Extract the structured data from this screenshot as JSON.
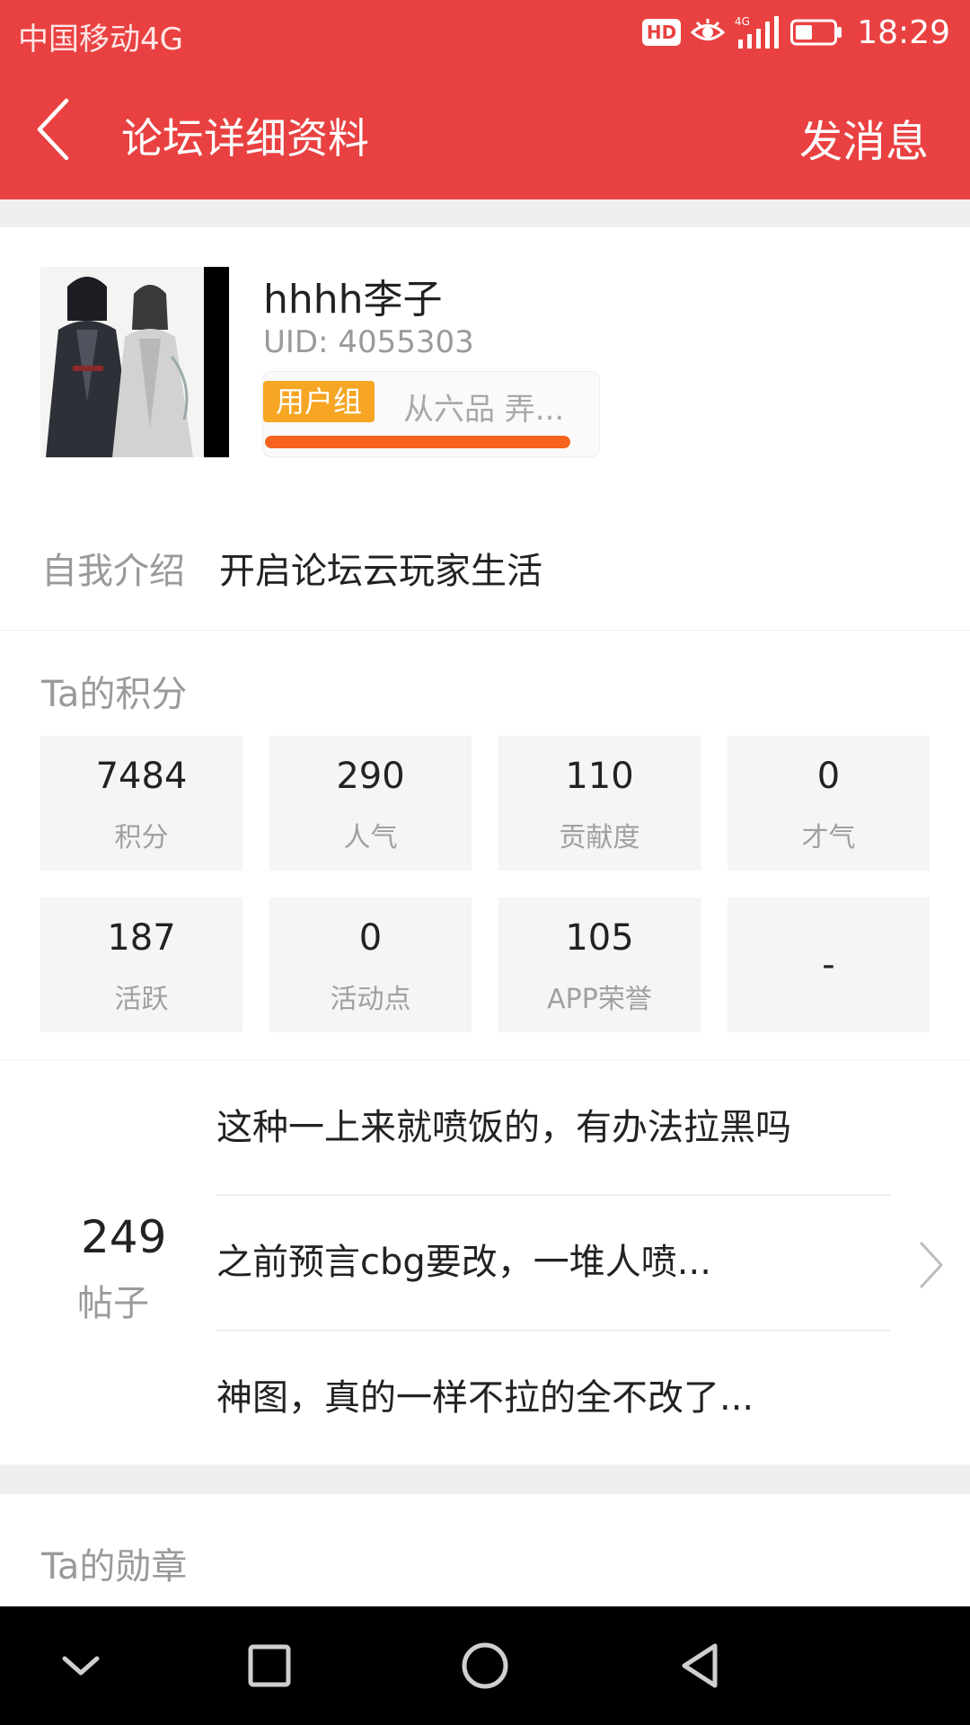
{
  "status_bar": {
    "carrier": "中国移动4G",
    "hd_badge": "HD",
    "network": "4G",
    "time": "18:29"
  },
  "app_bar": {
    "title": "论坛详细资料",
    "send_message": "发消息"
  },
  "profile": {
    "username": "hhhh李子",
    "uid_label": "UID:",
    "uid_value": "4055303",
    "group_badge": "用户组",
    "group_name": "从六品  弄...",
    "level_progress_percent": 100
  },
  "intro": {
    "label": "自我介绍",
    "text": "开启论坛云玩家生活"
  },
  "scores": {
    "title": "Ta的积分",
    "items": [
      {
        "value": "7484",
        "label": "积分"
      },
      {
        "value": "290",
        "label": "人气"
      },
      {
        "value": "110",
        "label": "贡献度"
      },
      {
        "value": "0",
        "label": "才气"
      },
      {
        "value": "187",
        "label": "活跃"
      },
      {
        "value": "0",
        "label": "活动点"
      },
      {
        "value": "105",
        "label": "APP荣誉"
      },
      {
        "value": "-",
        "label": ""
      }
    ]
  },
  "posts": {
    "count": "249",
    "label": "帖子",
    "items": [
      "这种一上来就喷饭的，有办法拉黑吗",
      "之前预言cbg要改，一堆人喷...",
      "神图，真的一样不拉的全不改了..."
    ]
  },
  "medals": {
    "title": "Ta的勋章"
  },
  "colors": {
    "brand_red": "#e94141",
    "badge_orange": "#f6a623",
    "level_bar": "#f5631e"
  }
}
